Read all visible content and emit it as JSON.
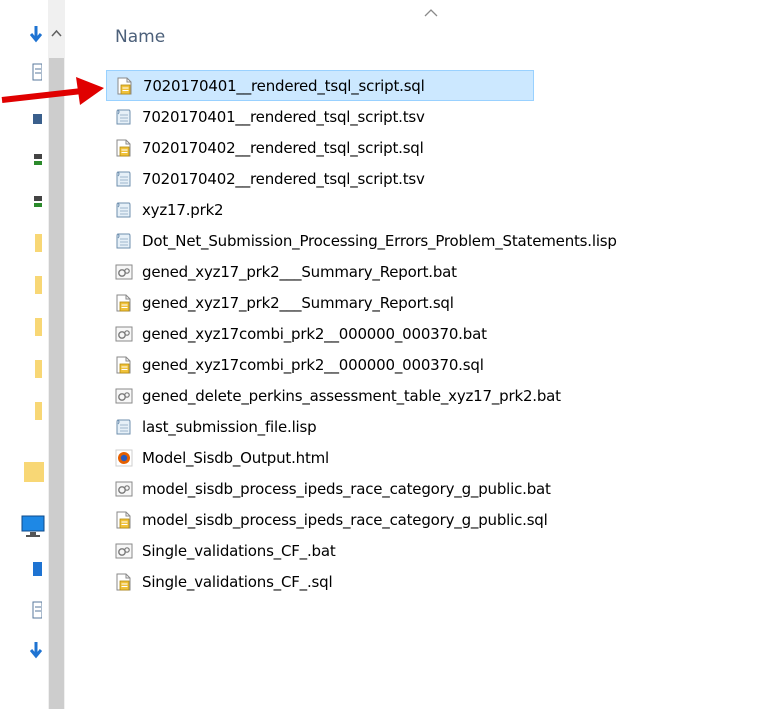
{
  "header": {
    "name_column": "Name"
  },
  "colors": {
    "selection": "#cce8ff",
    "selection_border": "#99d1ff",
    "arrow": "#e00000"
  },
  "files": [
    {
      "name": "7020170401__rendered_tsql_script.sql",
      "icon": "sql-script-icon",
      "selected": true
    },
    {
      "name": "7020170401__rendered_tsql_script.tsv",
      "icon": "text-file-icon"
    },
    {
      "name": "7020170402__rendered_tsql_script.sql",
      "icon": "sql-script-icon"
    },
    {
      "name": "7020170402__rendered_tsql_script.tsv",
      "icon": "text-file-icon"
    },
    {
      "name": "xyz17.prk2",
      "icon": "text-file-icon"
    },
    {
      "name": "Dot_Net_Submission_Processing_Errors_Problem_Statements.lisp",
      "icon": "text-file-icon"
    },
    {
      "name": "gened_xyz17_prk2___Summary_Report.bat",
      "icon": "batch-file-icon"
    },
    {
      "name": "gened_xyz17_prk2___Summary_Report.sql",
      "icon": "sql-script-icon"
    },
    {
      "name": "gened_xyz17combi_prk2__000000_000370.bat",
      "icon": "batch-file-icon"
    },
    {
      "name": "gened_xyz17combi_prk2__000000_000370.sql",
      "icon": "sql-script-icon"
    },
    {
      "name": "gened_delete_perkins_assessment_table_xyz17_prk2.bat",
      "icon": "batch-file-icon"
    },
    {
      "name": "last_submission_file.lisp",
      "icon": "text-file-icon"
    },
    {
      "name": "Model_Sisdb_Output.html",
      "icon": "firefox-html-icon"
    },
    {
      "name": "model_sisdb_process_ipeds_race_category_g_public.bat",
      "icon": "batch-file-icon"
    },
    {
      "name": "model_sisdb_process_ipeds_race_category_g_public.sql",
      "icon": "sql-script-icon"
    },
    {
      "name": "Single_validations_CF_.bat",
      "icon": "batch-file-icon"
    },
    {
      "name": "Single_validations_CF_.sql",
      "icon": "sql-script-icon"
    }
  ]
}
